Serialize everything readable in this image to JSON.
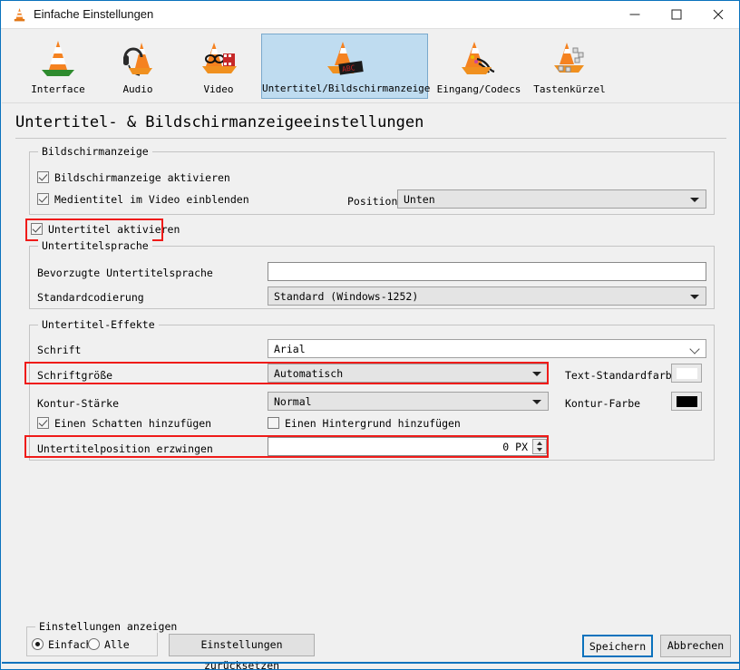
{
  "window": {
    "title": "Einfache Einstellungen",
    "icon": "vlc-cone-icon",
    "minimize_label": "—",
    "maximize_label": "□",
    "close_label": "✕"
  },
  "toolbar": {
    "items": [
      {
        "label": "Interface",
        "icon": "vlc-cone-icon",
        "selected": false
      },
      {
        "label": "Audio",
        "icon": "headphones-cone-icon",
        "selected": false
      },
      {
        "label": "Video",
        "icon": "cone-film-icon",
        "selected": false
      },
      {
        "label": "Untertitel/Bildschirmanzeige",
        "icon": "cone-subtitle-icon",
        "selected": true
      },
      {
        "label": "Eingang/Codecs",
        "icon": "cone-cables-icon",
        "selected": false
      },
      {
        "label": "Tastenkürzel",
        "icon": "cone-keyboard-icon",
        "selected": false
      }
    ]
  },
  "page": {
    "heading": "Untertitel- & Bildschirmanzeigeeinstellungen"
  },
  "osd_group": {
    "title": "Bildschirmanzeige",
    "enable_osd": {
      "label": "Bildschirmanzeige aktivieren",
      "checked": true
    },
    "show_media_title": {
      "label": "Medientitel im Video einblenden",
      "checked": true
    },
    "position_label": "Position",
    "position_value": "Unten"
  },
  "enable_subtitles": {
    "label": "Untertitel aktivieren",
    "checked": true,
    "highlighted": true
  },
  "language_group": {
    "title": "Untertitelsprache",
    "preferred_label": "Bevorzugte Untertitelsprache",
    "preferred_value": "",
    "encoding_label": "Standardcodierung",
    "encoding_value": "Standard (Windows-1252)"
  },
  "effects_group": {
    "title": "Untertitel-Effekte",
    "font_label": "Schrift",
    "font_value": "Arial",
    "font_size_label": "Schriftgröße",
    "font_size_value": "Automatisch",
    "font_size_highlighted": true,
    "text_color_label": "Text-Standardfarbe",
    "text_color_value": "#ffffff",
    "outline_thickness_label": "Kontur-Stärke",
    "outline_thickness_value": "Normal",
    "outline_color_label": "Kontur-Farbe",
    "outline_color_value": "#000000",
    "add_shadow": {
      "label": "Einen Schatten hinzufügen",
      "checked": true
    },
    "add_background": {
      "label": "Einen Hintergrund hinzufügen",
      "checked": false
    },
    "force_position_label": "Untertitelposition erzwingen",
    "force_position_value": "0 PX",
    "force_position_highlighted": true
  },
  "footer": {
    "show_settings_title": "Einstellungen anzeigen",
    "simple_label": "Einfach",
    "all_label": "Alle",
    "simple_selected": true,
    "reset_label": "Einstellungen zurücksetzen",
    "save_label": "Speichern",
    "cancel_label": "Abbrechen"
  },
  "colors": {
    "accent": "#0a72bd",
    "selection": "#bfdcf0",
    "highlight": "#ef1b19"
  }
}
